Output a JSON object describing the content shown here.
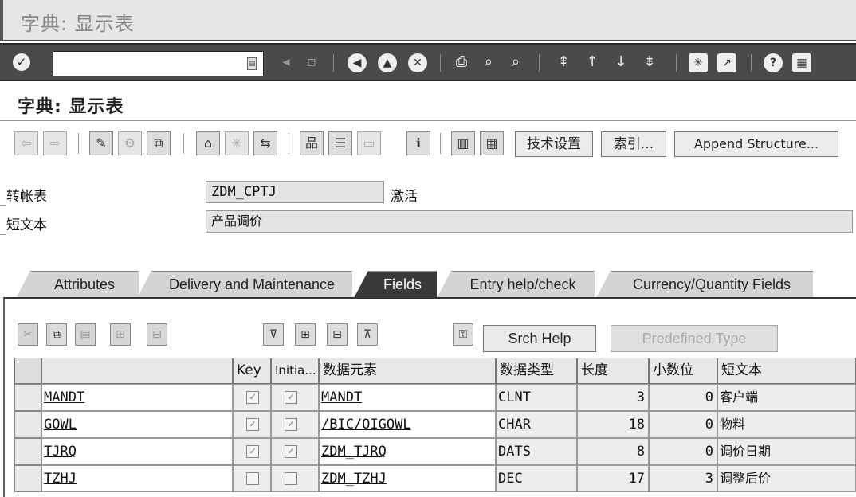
{
  "window_title": "字典: 显示表",
  "screen_title": "字典: 显示表",
  "toolbar": {
    "technical_settings_label": "技术设置",
    "indexes_label": "索引...",
    "append_structure_label": "Append Structure..."
  },
  "header": {
    "table_label": "转帐表",
    "table_value": "ZDM_CPTJ",
    "status": "激活",
    "short_text_label": "短文本",
    "short_text_value": "产品调价"
  },
  "tabs": [
    {
      "label": "Attributes"
    },
    {
      "label": "Delivery and Maintenance"
    },
    {
      "label": "Fields"
    },
    {
      "label": "Entry help/check"
    },
    {
      "label": "Currency/Quantity Fields"
    }
  ],
  "active_tab": "Fields",
  "table_toolbar": {
    "srch_help_label": "Srch Help",
    "predefined_type_label": "Predefined Type"
  },
  "table": {
    "columns": [
      "",
      "Key",
      "Initia...",
      "数据元素",
      "数据类型",
      "长度",
      "小数位",
      "短文本"
    ],
    "rows": [
      {
        "field": "MANDT",
        "key": true,
        "initial": true,
        "data_element": "MANDT",
        "data_type": "CLNT",
        "length": "3",
        "decimals": "0",
        "short_text": "客户端"
      },
      {
        "field": "GOWL",
        "key": true,
        "initial": true,
        "data_element": "/BIC/OIGOWL",
        "data_type": "CHAR",
        "length": "18",
        "decimals": "0",
        "short_text": "物料"
      },
      {
        "field": "TJRQ",
        "key": true,
        "initial": true,
        "data_element": "ZDM_TJRQ",
        "data_type": "DATS",
        "length": "8",
        "decimals": "0",
        "short_text": "调价日期"
      },
      {
        "field": "TZHJ",
        "key": false,
        "initial": false,
        "data_element": "ZDM_TZHJ",
        "data_type": "DEC",
        "length": "17",
        "decimals": "3",
        "short_text": "调整后价"
      }
    ]
  }
}
